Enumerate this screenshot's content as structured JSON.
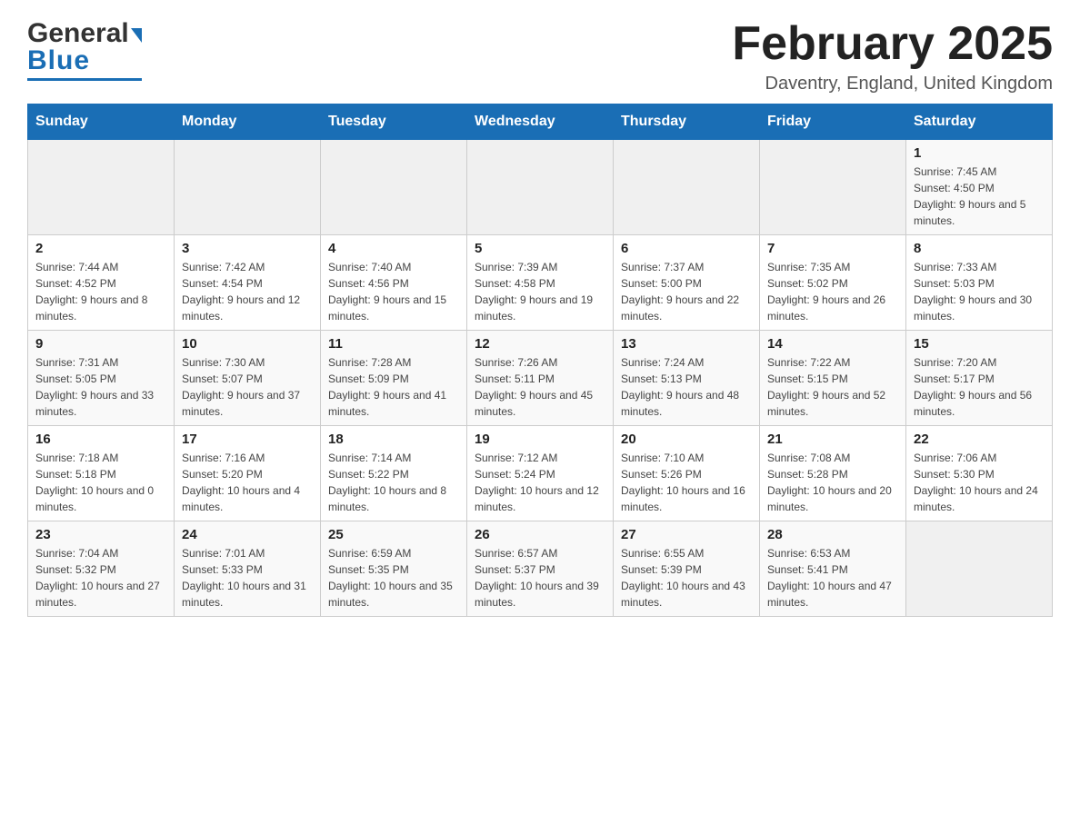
{
  "logo": {
    "text_general": "General",
    "text_blue": "Blue"
  },
  "header": {
    "month_title": "February 2025",
    "location": "Daventry, England, United Kingdom"
  },
  "days_of_week": [
    "Sunday",
    "Monday",
    "Tuesday",
    "Wednesday",
    "Thursday",
    "Friday",
    "Saturday"
  ],
  "weeks": [
    [
      {
        "day": "",
        "info": ""
      },
      {
        "day": "",
        "info": ""
      },
      {
        "day": "",
        "info": ""
      },
      {
        "day": "",
        "info": ""
      },
      {
        "day": "",
        "info": ""
      },
      {
        "day": "",
        "info": ""
      },
      {
        "day": "1",
        "info": "Sunrise: 7:45 AM\nSunset: 4:50 PM\nDaylight: 9 hours and 5 minutes."
      }
    ],
    [
      {
        "day": "2",
        "info": "Sunrise: 7:44 AM\nSunset: 4:52 PM\nDaylight: 9 hours and 8 minutes."
      },
      {
        "day": "3",
        "info": "Sunrise: 7:42 AM\nSunset: 4:54 PM\nDaylight: 9 hours and 12 minutes."
      },
      {
        "day": "4",
        "info": "Sunrise: 7:40 AM\nSunset: 4:56 PM\nDaylight: 9 hours and 15 minutes."
      },
      {
        "day": "5",
        "info": "Sunrise: 7:39 AM\nSunset: 4:58 PM\nDaylight: 9 hours and 19 minutes."
      },
      {
        "day": "6",
        "info": "Sunrise: 7:37 AM\nSunset: 5:00 PM\nDaylight: 9 hours and 22 minutes."
      },
      {
        "day": "7",
        "info": "Sunrise: 7:35 AM\nSunset: 5:02 PM\nDaylight: 9 hours and 26 minutes."
      },
      {
        "day": "8",
        "info": "Sunrise: 7:33 AM\nSunset: 5:03 PM\nDaylight: 9 hours and 30 minutes."
      }
    ],
    [
      {
        "day": "9",
        "info": "Sunrise: 7:31 AM\nSunset: 5:05 PM\nDaylight: 9 hours and 33 minutes."
      },
      {
        "day": "10",
        "info": "Sunrise: 7:30 AM\nSunset: 5:07 PM\nDaylight: 9 hours and 37 minutes."
      },
      {
        "day": "11",
        "info": "Sunrise: 7:28 AM\nSunset: 5:09 PM\nDaylight: 9 hours and 41 minutes."
      },
      {
        "day": "12",
        "info": "Sunrise: 7:26 AM\nSunset: 5:11 PM\nDaylight: 9 hours and 45 minutes."
      },
      {
        "day": "13",
        "info": "Sunrise: 7:24 AM\nSunset: 5:13 PM\nDaylight: 9 hours and 48 minutes."
      },
      {
        "day": "14",
        "info": "Sunrise: 7:22 AM\nSunset: 5:15 PM\nDaylight: 9 hours and 52 minutes."
      },
      {
        "day": "15",
        "info": "Sunrise: 7:20 AM\nSunset: 5:17 PM\nDaylight: 9 hours and 56 minutes."
      }
    ],
    [
      {
        "day": "16",
        "info": "Sunrise: 7:18 AM\nSunset: 5:18 PM\nDaylight: 10 hours and 0 minutes."
      },
      {
        "day": "17",
        "info": "Sunrise: 7:16 AM\nSunset: 5:20 PM\nDaylight: 10 hours and 4 minutes."
      },
      {
        "day": "18",
        "info": "Sunrise: 7:14 AM\nSunset: 5:22 PM\nDaylight: 10 hours and 8 minutes."
      },
      {
        "day": "19",
        "info": "Sunrise: 7:12 AM\nSunset: 5:24 PM\nDaylight: 10 hours and 12 minutes."
      },
      {
        "day": "20",
        "info": "Sunrise: 7:10 AM\nSunset: 5:26 PM\nDaylight: 10 hours and 16 minutes."
      },
      {
        "day": "21",
        "info": "Sunrise: 7:08 AM\nSunset: 5:28 PM\nDaylight: 10 hours and 20 minutes."
      },
      {
        "day": "22",
        "info": "Sunrise: 7:06 AM\nSunset: 5:30 PM\nDaylight: 10 hours and 24 minutes."
      }
    ],
    [
      {
        "day": "23",
        "info": "Sunrise: 7:04 AM\nSunset: 5:32 PM\nDaylight: 10 hours and 27 minutes."
      },
      {
        "day": "24",
        "info": "Sunrise: 7:01 AM\nSunset: 5:33 PM\nDaylight: 10 hours and 31 minutes."
      },
      {
        "day": "25",
        "info": "Sunrise: 6:59 AM\nSunset: 5:35 PM\nDaylight: 10 hours and 35 minutes."
      },
      {
        "day": "26",
        "info": "Sunrise: 6:57 AM\nSunset: 5:37 PM\nDaylight: 10 hours and 39 minutes."
      },
      {
        "day": "27",
        "info": "Sunrise: 6:55 AM\nSunset: 5:39 PM\nDaylight: 10 hours and 43 minutes."
      },
      {
        "day": "28",
        "info": "Sunrise: 6:53 AM\nSunset: 5:41 PM\nDaylight: 10 hours and 47 minutes."
      },
      {
        "day": "",
        "info": ""
      }
    ]
  ]
}
